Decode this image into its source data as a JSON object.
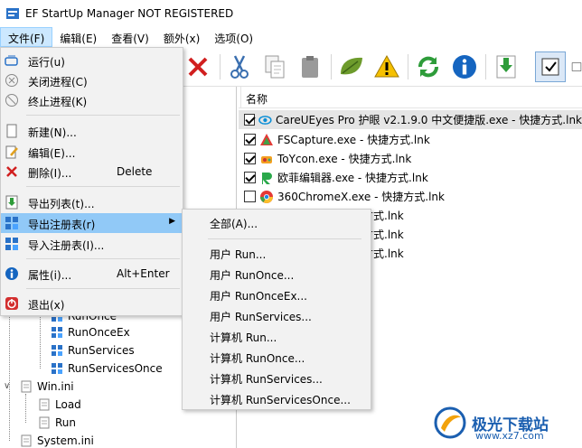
{
  "window": {
    "title": "EF StartUp Manager NOT REGISTERED"
  },
  "menubar": [
    {
      "label": "文件(F)",
      "active": true
    },
    {
      "label": "编辑(E)"
    },
    {
      "label": "查看(V)"
    },
    {
      "label": "额外(x)"
    },
    {
      "label": "选项(O)"
    }
  ],
  "toolbar": {
    "icons": [
      "delete-x-icon",
      "cut-icon",
      "copy-icon",
      "paste-icon",
      "leaf-icon",
      "warning-icon",
      "refresh-icon",
      "info-icon",
      "download-icon",
      "checked-view-icon",
      "window-icon"
    ]
  },
  "list": {
    "header": "名称",
    "rows": [
      {
        "text": "CareUEyes Pro 护眼 v2.1.9.0 中文便捷版.exe - 快捷方式.lnk",
        "checked": true,
        "selected": true,
        "icon": "eye-icon"
      },
      {
        "text": "FSCapture.exe - 快捷方式.lnk",
        "checked": true,
        "icon": "fscapture-icon"
      },
      {
        "text": "ToYcon.exe - 快捷方式.lnk",
        "checked": true,
        "icon": "toycon-icon"
      },
      {
        "text": "欧菲编辑器.exe - 快捷方式.lnk",
        "checked": true,
        "icon": "editor-icon"
      },
      {
        "text": "360ChromeX.exe - 快捷方式.lnk",
        "checked": false,
        "icon": "chrome-icon"
      },
      {
        "text": "方式.lnk",
        "checked": false,
        "icon": "app-icon"
      },
      {
        "text": "方式.lnk",
        "checked": false,
        "icon": "app-icon"
      },
      {
        "text": "捷方式.lnk",
        "checked": false,
        "icon": "app-icon"
      }
    ]
  },
  "tree": {
    "items": [
      {
        "label": "RunOnce"
      },
      {
        "label": "RunOnceEx"
      },
      {
        "label": "RunServices"
      },
      {
        "label": "RunServicesOnce"
      },
      {
        "label": "Win.ini"
      },
      {
        "label": "Load"
      },
      {
        "label": "Run"
      },
      {
        "label": "System.ini"
      }
    ]
  },
  "file_menu": {
    "items": [
      {
        "label": "运行(u)",
        "shortcut": ""
      },
      {
        "label": "关闭进程(C)",
        "shortcut": ""
      },
      {
        "label": "终止进程(K)",
        "shortcut": ""
      },
      {
        "label": "新建(N)...",
        "shortcut": ""
      },
      {
        "label": "编辑(E)...",
        "shortcut": ""
      },
      {
        "label": "删除(I)...",
        "shortcut": "Delete"
      },
      {
        "label": "导出列表(t)...",
        "shortcut": ""
      },
      {
        "label": "导出注册表(r)",
        "shortcut": ""
      },
      {
        "label": "导入注册表(I)...",
        "shortcut": ""
      },
      {
        "label": "属性(i)...",
        "shortcut": "Alt+Enter"
      },
      {
        "label": "退出(x)",
        "shortcut": ""
      }
    ]
  },
  "export_submenu": {
    "items": [
      "全部(A)...",
      "用户 Run...",
      "用户 RunOnce...",
      "用户 RunOnceEx...",
      "用户 RunServices...",
      "计算机 Run...",
      "计算机 RunOnce...",
      "计算机 RunServices...",
      "计算机 RunServicesOnce..."
    ]
  },
  "watermark": {
    "text": "极光下载站",
    "url": "www.xz7.com"
  },
  "colors": {
    "menu_highlight": "#91c9f7",
    "menu_bg": "#f2f2f2",
    "selected_row": "#e5e5e5",
    "accent_blue": "#1b5fb0"
  }
}
